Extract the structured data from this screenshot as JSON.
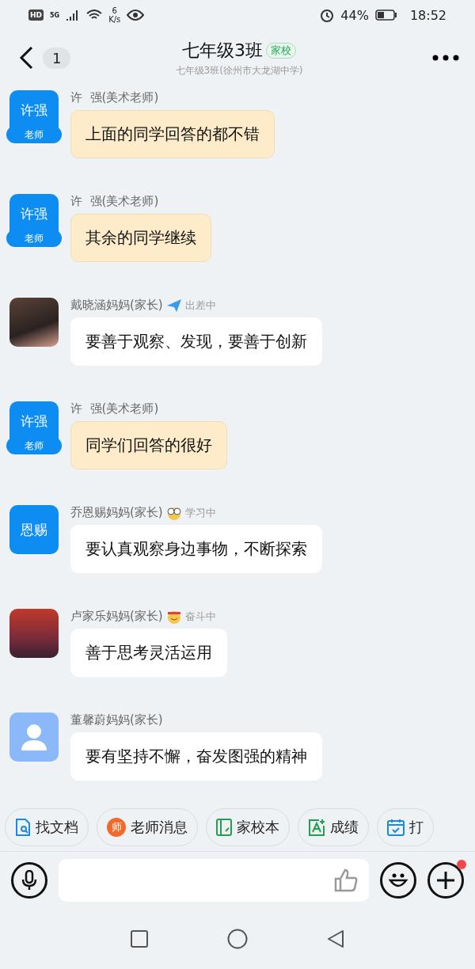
{
  "status_bar": {
    "hd": "HD",
    "network": "5G",
    "speed_value": "6",
    "speed_unit": "K/s",
    "battery": "44%",
    "time": "18:52"
  },
  "header": {
    "back_count": "1",
    "title": "七年级3班",
    "tag": "家校",
    "subtitle": "七年级3班(徐州市大龙湖中学)"
  },
  "messages": [
    {
      "kind": "teacher",
      "sender": "许  强(美术老师)",
      "avatar": {
        "kind": "teacher",
        "text": "许强",
        "badge": "老师"
      },
      "text": "上面的同学回答的都不错"
    },
    {
      "kind": "teacher",
      "sender": "许  强(美术老师)",
      "avatar": {
        "kind": "teacher",
        "text": "许强",
        "badge": "老师"
      },
      "text": "其余的同学继续"
    },
    {
      "kind": "parent",
      "sender": "戴晓涵妈妈(家长)",
      "avatar": {
        "kind": "photo"
      },
      "status": {
        "kind": "plane",
        "text": "出差中"
      },
      "text": "要善于观察、发现，要善于创新"
    },
    {
      "kind": "teacher",
      "sender": "许  强(美术老师)",
      "avatar": {
        "kind": "teacher",
        "text": "许强",
        "badge": "老师"
      },
      "text": "同学们回答的很好"
    },
    {
      "kind": "parent",
      "sender": "乔恩赐妈妈(家长)",
      "avatar": {
        "kind": "name",
        "text": "恩赐"
      },
      "status": {
        "kind": "glasses",
        "text": "学习中"
      },
      "text": "要认真观察身边事物，不断探索"
    },
    {
      "kind": "parent",
      "sender": "卢家乐妈妈(家长)",
      "avatar": {
        "kind": "sunset"
      },
      "status": {
        "kind": "strive",
        "text": "奋斗中"
      },
      "text": "善于思考灵活运用"
    },
    {
      "kind": "parent",
      "sender": "董馨蔚妈妈(家长)",
      "avatar": {
        "kind": "default"
      },
      "text": "要有坚持不懈，奋发图强的精神"
    }
  ],
  "shortcuts": [
    {
      "kind": "doc",
      "label": "找文档"
    },
    {
      "kind": "teacher",
      "label": "老师消息",
      "icon_char": "师"
    },
    {
      "kind": "book",
      "label": "家校本"
    },
    {
      "kind": "grade",
      "label": "成绩"
    },
    {
      "kind": "calendar",
      "label": "打"
    }
  ],
  "composer": {
    "plus_badge": true
  }
}
